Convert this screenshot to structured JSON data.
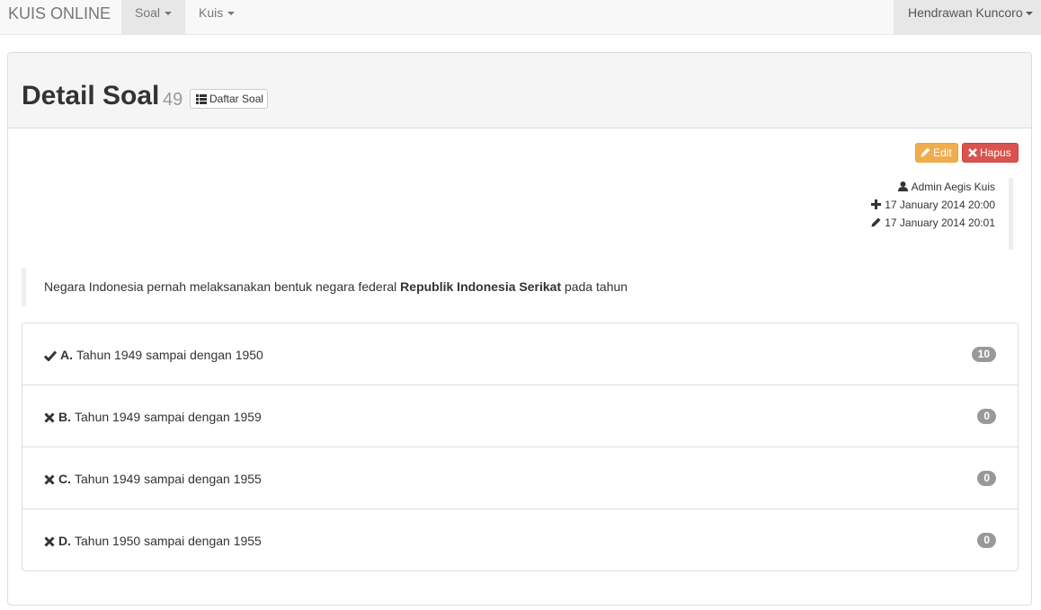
{
  "navbar": {
    "brand": "KUIS ONLINE",
    "menu": [
      {
        "label": "Soal",
        "active": true
      },
      {
        "label": "Kuis",
        "active": false
      }
    ],
    "user": "Hendrawan Kuncoro"
  },
  "header": {
    "title": "Detail Soal",
    "count": "49",
    "list_button": "Daftar Soal"
  },
  "actions": {
    "edit_label": "Edit",
    "delete_label": "Hapus"
  },
  "meta": {
    "author": "Admin Aegis Kuis",
    "created": "17 January 2014 20:00",
    "updated": "17 January 2014 20:01"
  },
  "question": {
    "text_before": "Negara Indonesia pernah melaksanakan bentuk negara federal ",
    "text_bold": "Republik Indonesia Serikat",
    "text_after": " pada tahun"
  },
  "options": [
    {
      "letter": "A.",
      "text": "Tahun 1949 sampai dengan 1950",
      "correct": true,
      "count": "10"
    },
    {
      "letter": "B.",
      "text": "Tahun 1949 sampai dengan 1959",
      "correct": false,
      "count": "0"
    },
    {
      "letter": "C.",
      "text": "Tahun 1949 sampai dengan 1955",
      "correct": false,
      "count": "0"
    },
    {
      "letter": "D.",
      "text": "Tahun 1950 sampai dengan 1955",
      "correct": false,
      "count": "0"
    }
  ],
  "colors": {
    "edit": "#f0ad4e",
    "delete": "#d9534f",
    "badge": "#999999"
  }
}
